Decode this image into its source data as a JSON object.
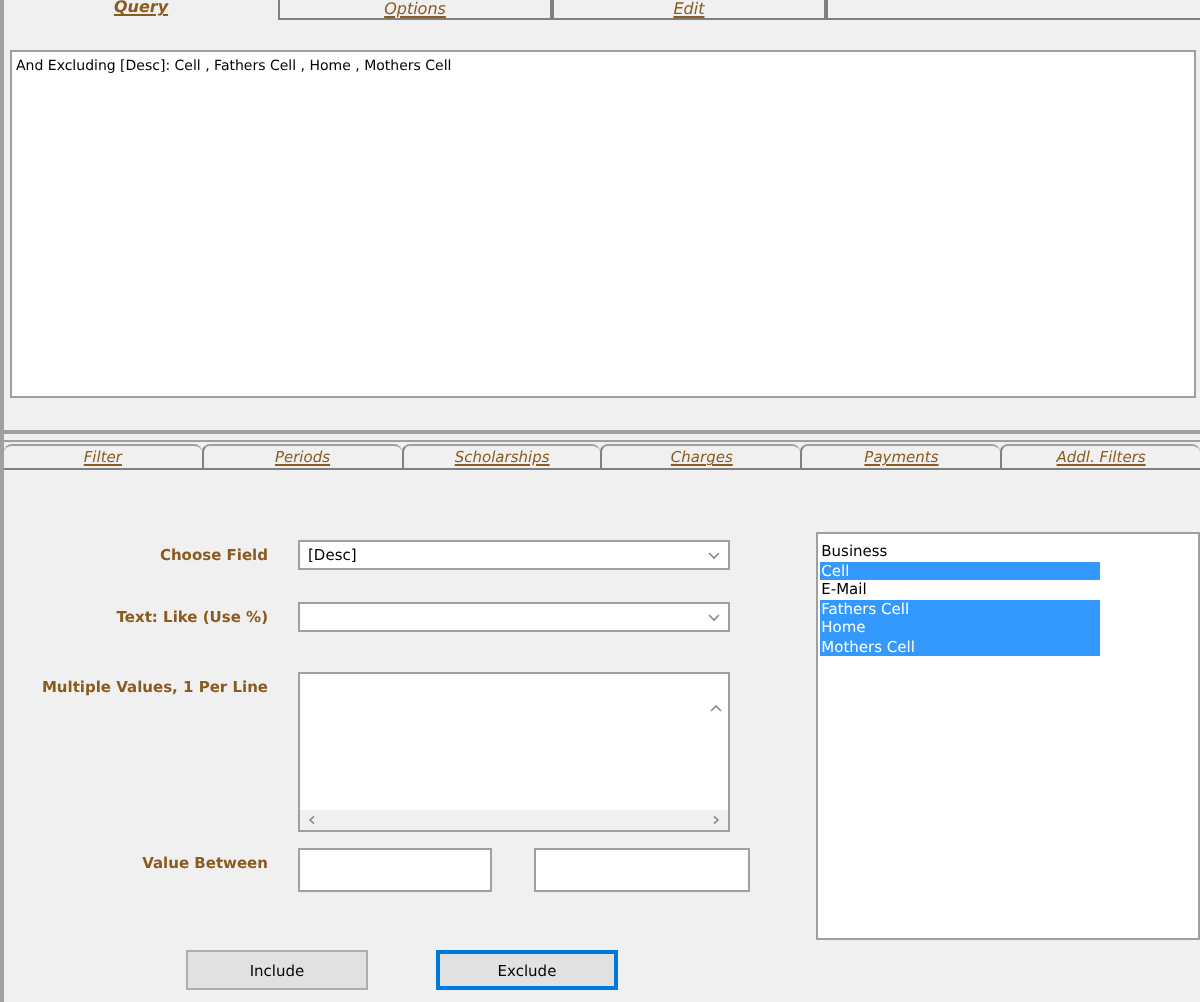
{
  "top_tabs": [
    {
      "label": "Query",
      "selected": true
    },
    {
      "label": "Options",
      "selected": false
    },
    {
      "label": "Edit",
      "selected": false
    }
  ],
  "query_text": "And Excluding [Desc]:  Cell , Fathers Cell , Home , Mothers Cell",
  "filter_tabs": [
    {
      "label": "Filter",
      "selected": false
    },
    {
      "label": "Periods",
      "selected": false
    },
    {
      "label": "Scholarships",
      "selected": false
    },
    {
      "label": "Charges",
      "selected": false
    },
    {
      "label": "Payments",
      "selected": false
    },
    {
      "label": "Addl. Filters",
      "selected": false
    }
  ],
  "form": {
    "choose_field": {
      "label": "Choose Field",
      "value": "[Desc]"
    },
    "text_like": {
      "label": "Text: Like (Use %)"
    },
    "multiple_values": {
      "label": "Multiple Values, 1 Per Line"
    },
    "value_between": {
      "label": "Value Between"
    }
  },
  "values_list": [
    {
      "label": "Business",
      "selected": false
    },
    {
      "label": "Cell",
      "selected": true
    },
    {
      "label": "E-Mail",
      "selected": false
    },
    {
      "label": "Fathers Cell",
      "selected": true
    },
    {
      "label": "Home",
      "selected": true
    },
    {
      "label": "Mothers Cell",
      "selected": true
    }
  ],
  "buttons": [
    {
      "label": "Include",
      "focused": false
    },
    {
      "label": "Exclude",
      "focused": true
    }
  ]
}
